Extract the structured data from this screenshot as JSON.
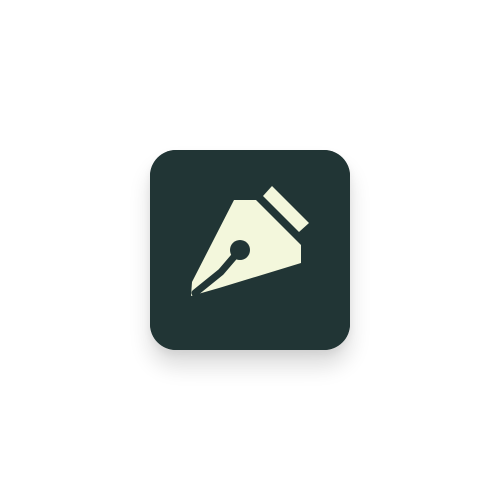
{
  "app_icon": {
    "icon": "fountain-pen-nib-icon",
    "colors": {
      "background": "#213535",
      "nib": "#f3f7dc"
    }
  }
}
